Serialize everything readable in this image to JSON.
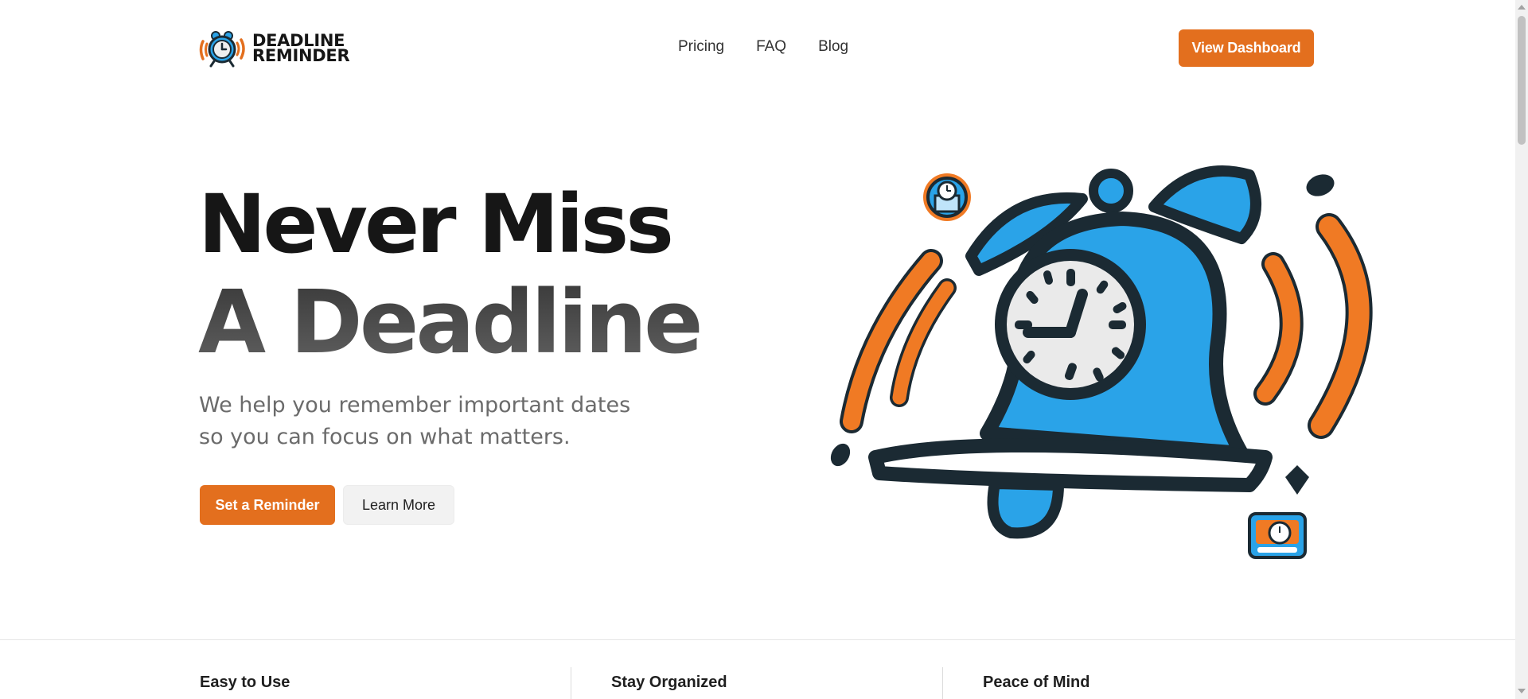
{
  "header": {
    "logo": {
      "line1": "DEADLINE",
      "line2": "REMINDER",
      "icon": "alarm-clock-icon"
    },
    "nav": [
      {
        "label": "Pricing"
      },
      {
        "label": "FAQ"
      },
      {
        "label": "Blog"
      }
    ],
    "cta_label": "View Dashboard"
  },
  "hero": {
    "title_line1": "Never Miss",
    "title_line2": "A Deadline",
    "subtitle_line1": "We help you remember important dates",
    "subtitle_line2": "so you can focus on what matters.",
    "primary_button": "Set a Reminder",
    "secondary_button": "Learn More",
    "illustration": "ringing-alarm-bell-illustration"
  },
  "features": [
    {
      "title": "Easy to Use"
    },
    {
      "title": "Stay Organized"
    },
    {
      "title": "Peace of Mind"
    }
  ],
  "colors": {
    "accent": "#e36f1e",
    "bell_blue": "#2aa3e8",
    "text_dark": "#161616",
    "text_muted": "#6b6b6b"
  }
}
